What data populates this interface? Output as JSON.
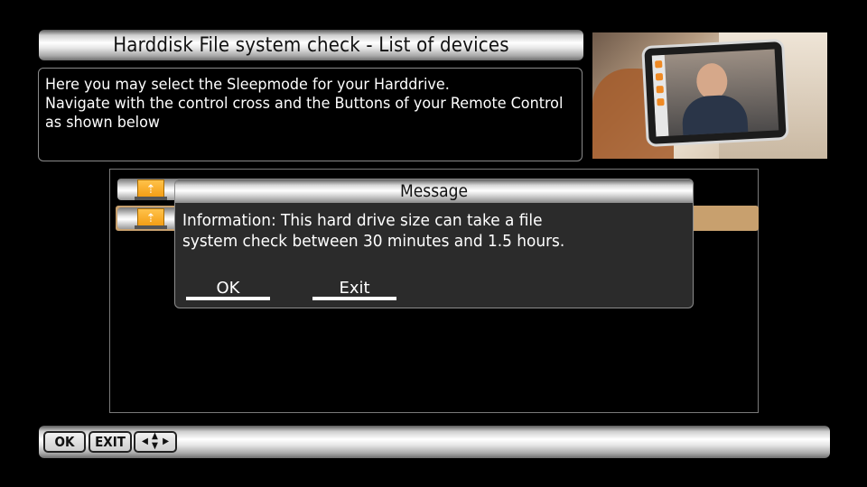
{
  "header": {
    "title": "Harddisk File system check - List of devices"
  },
  "description": {
    "lines": [
      "Here you may select the Sleepmode for your Harddrive.",
      "Navigate with the control cross and the Buttons of your Remote Control",
      "as shown below"
    ]
  },
  "preview": {
    "icon": "tablet-video-preview-image"
  },
  "devices": [
    {
      "icon": "usb-drive-icon",
      "selected": false
    },
    {
      "icon": "usb-drive-icon",
      "selected": true
    }
  ],
  "dialog": {
    "title": "Message",
    "message_lines": [
      "Information: This hard drive size can take a file",
      "system check between 30 minutes and 1.5 hours."
    ],
    "ok_label": "OK",
    "exit_label": "Exit"
  },
  "footer": {
    "ok_key": "OK",
    "exit_key": "EXIT",
    "dpad_icon": "dpad-arrows-icon"
  },
  "colors": {
    "selected_row": "#c8a06e",
    "dialog_bg": "#2b2b2b",
    "usb_icon": "#f29a10"
  }
}
